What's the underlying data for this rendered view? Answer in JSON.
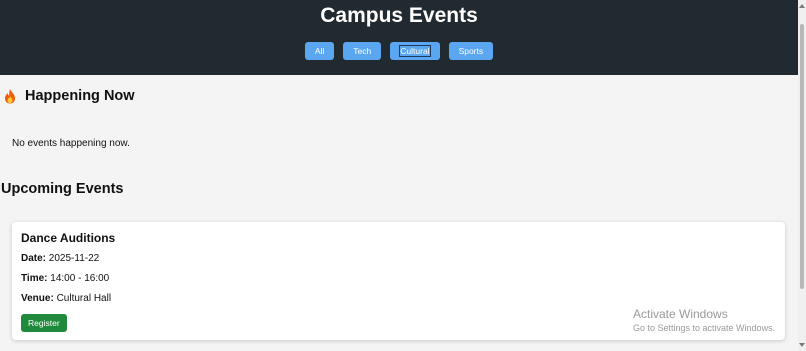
{
  "header": {
    "title": "Campus Events",
    "filters": [
      "All",
      "Tech",
      "Cultural",
      "Sports"
    ]
  },
  "happening": {
    "icon": "fire-icon",
    "title": "Happening Now",
    "empty_text": "No events happening now."
  },
  "upcoming": {
    "title": "Upcoming Events",
    "events": [
      {
        "title": "Dance Auditions",
        "date_label": "Date:",
        "date": "2025-11-22",
        "time_label": "Time:",
        "time": "14:00 - 16:00",
        "venue_label": "Venue:",
        "venue": "Cultural Hall",
        "register_label": "Register"
      }
    ]
  },
  "watermark": {
    "line1": "Activate Windows",
    "line2": "Go to Settings to activate Windows."
  },
  "colors": {
    "header_bg": "#222a31",
    "filter_button": "#5aa6f1",
    "register_button": "#1f8a3b"
  }
}
